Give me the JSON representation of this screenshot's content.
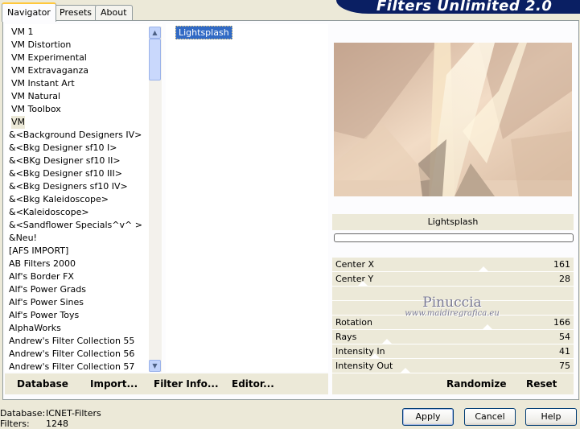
{
  "tabs": [
    {
      "label": "Navigator",
      "active": true
    },
    {
      "label": "Presets",
      "active": false
    },
    {
      "label": "About",
      "active": false
    }
  ],
  "banner": {
    "title": "Filters Unlimited 2.0"
  },
  "categories": [
    "VM 1",
    "VM Distortion",
    "VM Experimental",
    "VM Extravaganza",
    "VM Instant Art",
    "VM Natural",
    "VM Toolbox",
    "VM",
    "&<Background Designers IV>",
    "&<Bkg Designer sf10 I>",
    "&<BKg Designer sf10 II>",
    "&<Bkg Designer sf10 III>",
    "&<Bkg Designers sf10 IV>",
    "&<Bkg Kaleidoscope>",
    "&<Kaleidoscope>",
    "&<Sandflower Specials^v^ >",
    "&Neu!",
    "[AFS IMPORT]",
    "AB Filters 2000",
    "Alf's Border FX",
    "Alf's Power Grads",
    "Alf's Power Sines",
    "Alf's Power Toys",
    "AlphaWorks",
    "Andrew's Filter Collection 55",
    "Andrew's Filter Collection 56",
    "Andrew's Filter Collection 57"
  ],
  "selected_category": "VM",
  "filters": [
    "Lightsplash"
  ],
  "selected_filter": "Lightsplash",
  "filter_name": "Lightsplash",
  "params": [
    {
      "label": "Center X",
      "value": "161",
      "max": 255
    },
    {
      "label": "Center Y",
      "value": "28",
      "max": 255
    },
    {
      "label": "",
      "value": "",
      "max": 255
    },
    {
      "label": "",
      "value": "",
      "max": 255
    },
    {
      "label": "Rotation",
      "value": "166",
      "max": 255
    },
    {
      "label": "Rays",
      "value": "54",
      "max": 255
    },
    {
      "label": "Intensity In",
      "value": "41",
      "max": 255
    },
    {
      "label": "Intensity Out",
      "value": "75",
      "max": 255
    }
  ],
  "watermark": {
    "line1": "Pinuccia",
    "line2": "www.maidiregrafica.eu"
  },
  "toolbar_left": {
    "database": "Database",
    "import": "Import...",
    "filter_info": "Filter Info...",
    "editor": "Editor..."
  },
  "toolbar_right": {
    "randomize": "Randomize",
    "reset": "Reset"
  },
  "status": {
    "database_label": "Database:",
    "database_value": "ICNET-Filters",
    "filters_label": "Filters:",
    "filters_value": "1248"
  },
  "buttons": {
    "apply": "Apply",
    "cancel": "Cancel",
    "help": "Help"
  },
  "icons": {
    "scroll_up": "chevron-up-icon",
    "scroll_down": "chevron-down-icon"
  },
  "colors": {
    "banner": "#0a1f63",
    "selection": "#316ac5",
    "tab_highlight": "#ffc83c"
  }
}
